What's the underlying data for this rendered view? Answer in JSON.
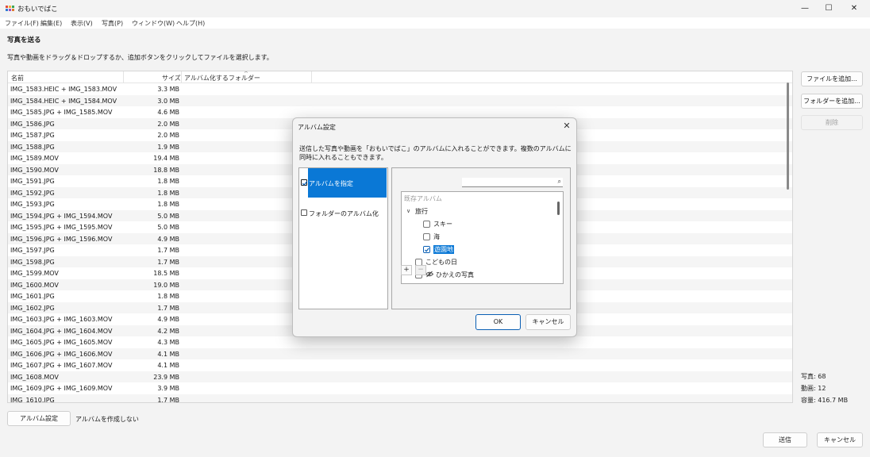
{
  "window": {
    "title": "おもいでばこ",
    "minimize_glyph": "—",
    "maximize_glyph": "☐",
    "close_glyph": "✕"
  },
  "menu": [
    "ファイル(F)",
    "編集(E)",
    "表示(V)",
    "写真(P)",
    "ウィンドウ(W)",
    "ヘルプ(H)"
  ],
  "page": {
    "heading": "写真を送る",
    "description": "写真や動画をドラッグ＆ドロップするか、追加ボタンをクリックしてファイルを選択します。"
  },
  "table": {
    "columns": {
      "name": "名前",
      "size": "サイズ",
      "folder": "アルバム化するフォルダー"
    },
    "sort_caret": "^",
    "rows": [
      {
        "name": "IMG_1583.HEIC + IMG_1583.MOV",
        "size": "3.3 MB"
      },
      {
        "name": "IMG_1584.HEIC + IMG_1584.MOV",
        "size": "3.0 MB"
      },
      {
        "name": "IMG_1585.JPG + IMG_1585.MOV",
        "size": "4.6 MB"
      },
      {
        "name": "IMG_1586.JPG",
        "size": "2.0 MB"
      },
      {
        "name": "IMG_1587.JPG",
        "size": "2.0 MB"
      },
      {
        "name": "IMG_1588.JPG",
        "size": "1.9 MB"
      },
      {
        "name": "IMG_1589.MOV",
        "size": "19.4 MB"
      },
      {
        "name": "IMG_1590.MOV",
        "size": "18.8 MB"
      },
      {
        "name": "IMG_1591.JPG",
        "size": "1.8 MB"
      },
      {
        "name": "IMG_1592.JPG",
        "size": "1.8 MB"
      },
      {
        "name": "IMG_1593.JPG",
        "size": "1.8 MB"
      },
      {
        "name": "IMG_1594.JPG + IMG_1594.MOV",
        "size": "5.0 MB"
      },
      {
        "name": "IMG_1595.JPG + IMG_1595.MOV",
        "size": "5.0 MB"
      },
      {
        "name": "IMG_1596.JPG + IMG_1596.MOV",
        "size": "4.9 MB"
      },
      {
        "name": "IMG_1597.JPG",
        "size": "1.7 MB"
      },
      {
        "name": "IMG_1598.JPG",
        "size": "1.7 MB"
      },
      {
        "name": "IMG_1599.MOV",
        "size": "18.5 MB"
      },
      {
        "name": "IMG_1600.MOV",
        "size": "19.0 MB"
      },
      {
        "name": "IMG_1601.JPG",
        "size": "1.8 MB"
      },
      {
        "name": "IMG_1602.JPG",
        "size": "1.7 MB"
      },
      {
        "name": "IMG_1603.JPG + IMG_1603.MOV",
        "size": "4.9 MB"
      },
      {
        "name": "IMG_1604.JPG + IMG_1604.MOV",
        "size": "4.2 MB"
      },
      {
        "name": "IMG_1605.JPG + IMG_1605.MOV",
        "size": "4.3 MB"
      },
      {
        "name": "IMG_1606.JPG + IMG_1606.MOV",
        "size": "4.1 MB"
      },
      {
        "name": "IMG_1607.JPG + IMG_1607.MOV",
        "size": "4.1 MB"
      },
      {
        "name": "IMG_1608.MOV",
        "size": "23.9 MB"
      },
      {
        "name": "IMG_1609.JPG + IMG_1609.MOV",
        "size": "3.9 MB"
      },
      {
        "name": "IMG_1610.JPG",
        "size": "1.7 MB"
      }
    ]
  },
  "side_buttons": {
    "add_files": "ファイルを追加...",
    "add_folder": "フォルダーを追加...",
    "delete": "削除"
  },
  "stats": {
    "photos": "写真: 68",
    "videos": "動画: 12",
    "capacity": "容量: 416.7 MB"
  },
  "bottom": {
    "album_settings_button": "アルバム設定",
    "album_status": "アルバムを作成しない",
    "send_button": "送信",
    "cancel_button": "キャンセル"
  },
  "dialog": {
    "title": "アルバム設定",
    "close_glyph": "✕",
    "description": "送信した写真や動画を「おもいでばこ」のアルバムに入れることができます。複数のアルバムに同時に入れることもできます。",
    "options": [
      {
        "label": "アルバムを指定",
        "checked": true
      },
      {
        "label": "フォルダーのアルバム化",
        "checked": false
      }
    ],
    "search_placeholder": "",
    "search_icon": "⌕",
    "tree_header": "既存アルバム",
    "tree": {
      "parent": "旅行",
      "parent_chevron": "∨",
      "children": [
        {
          "label": "スキー",
          "checked": false
        },
        {
          "label": "海",
          "checked": false
        },
        {
          "label": "遊園地",
          "checked": true
        }
      ],
      "others": [
        {
          "label": "こどもの日",
          "checked": false
        },
        {
          "label": "ひかえの写真",
          "checked": false,
          "icon": "hidden-eye-icon"
        }
      ]
    },
    "add_glyph": "+",
    "remove_glyph": "−",
    "ok": "OK",
    "cancel": "キャンセル"
  },
  "colors": {
    "accent": "#0a78d6",
    "window_bg": "#f3f3f3"
  }
}
